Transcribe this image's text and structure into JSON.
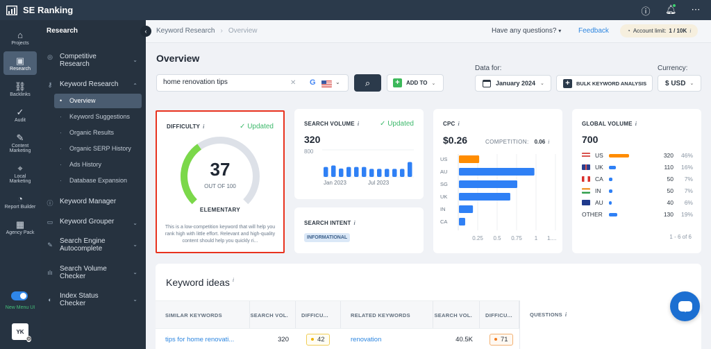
{
  "app": {
    "name": "SE Ranking"
  },
  "topbar": {
    "icons": [
      "help-icon",
      "bell-icon",
      "more-icon"
    ]
  },
  "rail": {
    "items": [
      {
        "label": "Projects",
        "icon": "home-icon",
        "glyph": "⌂"
      },
      {
        "label": "Research",
        "icon": "research-icon",
        "glyph": "▣",
        "active": true
      },
      {
        "label": "Backlinks",
        "icon": "link-icon",
        "glyph": "⛓"
      },
      {
        "label": "Audit",
        "icon": "check-circle-icon",
        "glyph": "✓"
      },
      {
        "label": "Content Marketing",
        "icon": "edit-icon",
        "glyph": "✎"
      },
      {
        "label": "Local Marketing",
        "icon": "location-icon",
        "glyph": "⌖"
      },
      {
        "label": "Report Builder",
        "icon": "pie-chart-icon",
        "glyph": "◔"
      },
      {
        "label": "Agency Pack",
        "icon": "building-icon",
        "glyph": "▦"
      }
    ],
    "toggle_label": "New Menu UI",
    "toggle_on": true,
    "avatar": "YK"
  },
  "subnav": {
    "title": "Research",
    "competitive": "Competitive Research",
    "keyword_research": "Keyword Research",
    "subitems": [
      "Overview",
      "Keyword Suggestions",
      "Organic Results",
      "Organic SERP History",
      "Ads History",
      "Database Expansion"
    ],
    "keyword_manager": "Keyword Manager",
    "keyword_grouper": "Keyword Grouper",
    "autocomplete": "Search Engine Autocomplete",
    "volume_checker": "Search Volume Checker",
    "index_checker": "Index Status Checker"
  },
  "header": {
    "breadcrumb": [
      "Keyword Research",
      "Overview"
    ],
    "questions": "Have any questions?",
    "feedback": "Feedback",
    "account_limit_label": "Account limit:",
    "account_limit_value": "1 / 10K"
  },
  "toolbar": {
    "title": "Overview",
    "search_value": "home renovation tips",
    "search_engine": "G",
    "add_to": "ADD TO",
    "data_for_label": "Data for:",
    "date": "January 2024",
    "bulk": "BULK KEYWORD ANALYSIS",
    "currency_label": "Currency:",
    "currency": "$ USD"
  },
  "difficulty": {
    "title": "DIFFICULTY",
    "status": "Updated",
    "value": 37,
    "max": 100,
    "value_text": "37",
    "out_of": "OUT OF 100",
    "level": "ELEMENTARY",
    "description": "This is a low-competition keyword that will help you rank high with little effort. Relevant and high-quality content should help you quickly ri...",
    "color": "#7bd84a"
  },
  "search_volume": {
    "title": "SEARCH VOLUME",
    "status": "Updated",
    "value": "320",
    "axis_max": "800",
    "x_labels": [
      "Jan 2023",
      "Jul 2023"
    ],
    "monthly": [
      260,
      300,
      220,
      260,
      260,
      260,
      210,
      210,
      210,
      210,
      210,
      390
    ]
  },
  "search_intent": {
    "title": "SEARCH INTENT",
    "badge": "INFORMATIONAL"
  },
  "cpc": {
    "title": "CPC",
    "value": "$0.26",
    "competition_label": "COMPETITION:",
    "competition_value": "0.06",
    "chart_data": {
      "type": "bar",
      "orientation": "horizontal",
      "categories": [
        "US",
        "AU",
        "SG",
        "UK",
        "IN",
        "CA"
      ],
      "values": [
        0.26,
        0.97,
        0.75,
        0.66,
        0.18,
        0.08
      ],
      "highlight": "US",
      "xticks": [
        "0.25",
        "0.5",
        "0.75",
        "1",
        "1...."
      ],
      "xlim": [
        0,
        1.25
      ],
      "colors": {
        "highlight": "#ff8c00",
        "default": "#2f80f5"
      }
    }
  },
  "global_volume": {
    "title": "GLOBAL VOLUME",
    "value": "700",
    "rows": [
      {
        "code": "US",
        "volume": 320,
        "volume_text": "320",
        "pct": "46%",
        "highlight": true
      },
      {
        "code": "UK",
        "volume": 110,
        "volume_text": "110",
        "pct": "16%"
      },
      {
        "code": "CA",
        "volume": 50,
        "volume_text": "50",
        "pct": "7%"
      },
      {
        "code": "IN",
        "volume": 50,
        "volume_text": "50",
        "pct": "7%"
      },
      {
        "code": "AU",
        "volume": 40,
        "volume_text": "40",
        "pct": "6%"
      },
      {
        "code": "OTHER",
        "volume": 130,
        "volume_text": "130",
        "pct": "19%"
      }
    ],
    "pager": "1 - 6 of 6"
  },
  "keyword_ideas": {
    "title": "Keyword ideas",
    "headers": [
      "SIMILAR KEYWORDS",
      "SEARCH VOL.",
      "DIFFICU...",
      "RELATED KEYWORDS",
      "SEARCH VOL.",
      "DIFFICU...",
      "QUESTIONS"
    ],
    "rows": [
      {
        "similar": "tips for home renovati...",
        "similar_vol": "320",
        "similar_diff": "42",
        "related": "renovation",
        "related_vol": "40.5K",
        "related_diff": "71"
      }
    ]
  }
}
